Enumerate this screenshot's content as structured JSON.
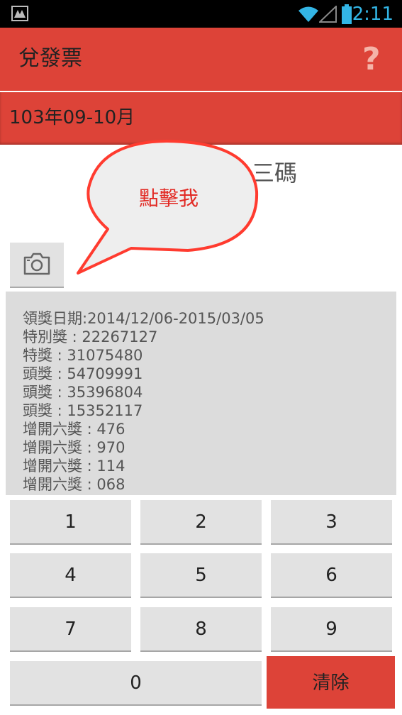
{
  "status_bar": {
    "time": "2:11",
    "icons": [
      "notification-gallery-icon",
      "wifi-icon",
      "signal-icon",
      "battery-icon"
    ]
  },
  "app_bar": {
    "title": "兌發票",
    "help_icon": "?"
  },
  "period": "103年09-10月",
  "mode_label": "三碼",
  "callout": "點擊我",
  "info": {
    "lines": [
      "領獎日期:2014/12/06-2015/03/05",
      "特別獎 : 22267127",
      "特獎 : 31075480",
      "頭獎 : 54709991",
      "頭獎 : 35396804",
      "頭獎 : 15352117",
      "增開六獎 : 476",
      "增開六獎 : 970",
      "增開六獎 : 114",
      "增開六獎 : 068"
    ]
  },
  "keypad": {
    "k1": "1",
    "k2": "2",
    "k3": "3",
    "k4": "4",
    "k5": "5",
    "k6": "6",
    "k7": "7",
    "k8": "8",
    "k9": "9",
    "k0": "0",
    "clear": "清除"
  },
  "colors": {
    "accent": "#dd4338",
    "callout_text": "#e22a24",
    "status_time": "#33b5e5"
  }
}
